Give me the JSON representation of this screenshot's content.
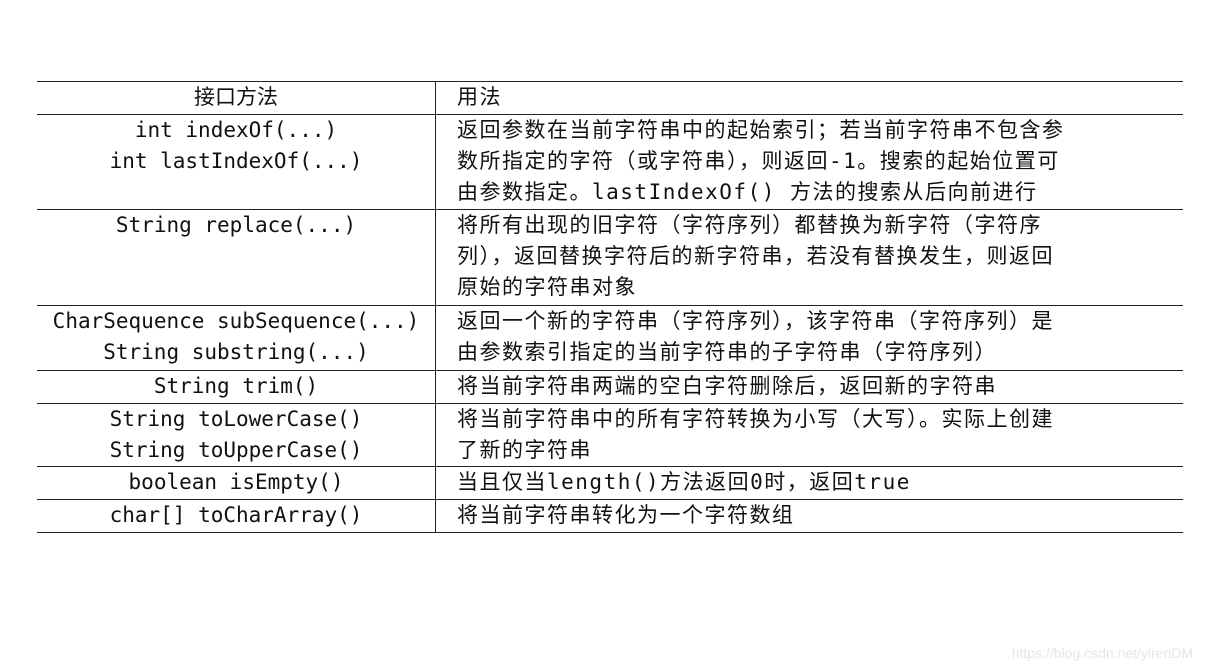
{
  "table": {
    "headers": [
      "接口方法",
      "用法"
    ],
    "rows": [
      {
        "method": [
          "int indexOf(...)",
          "int lastIndexOf(...)"
        ],
        "usage": [
          "返回参数在当前字符串中的起始索引；若当前字符串不包含参",
          "数所指定的字符（或字符串），则返回-1。搜索的起始位置可",
          "由参数指定。lastIndexOf() 方法的搜索从后向前进行"
        ]
      },
      {
        "method": [
          "String replace(...)"
        ],
        "usage": [
          "将所有出现的旧字符（字符序列）都替换为新字符（字符序",
          "列），返回替换字符后的新字符串，若没有替换发生，则返回",
          "原始的字符串对象"
        ]
      },
      {
        "method": [
          "CharSequence subSequence(...)",
          "String substring(...)"
        ],
        "usage": [
          "返回一个新的字符串（字符序列），该字符串（字符序列）是",
          "由参数索引指定的当前字符串的子字符串（字符序列）"
        ]
      },
      {
        "method": [
          "String trim()"
        ],
        "usage": [
          "将当前字符串两端的空白字符删除后，返回新的字符串"
        ]
      },
      {
        "method": [
          "String toLowerCase()",
          "String toUpperCase()"
        ],
        "usage": [
          "将当前字符串中的所有字符转换为小写（大写）。实际上创建",
          "了新的字符串"
        ]
      },
      {
        "method": [
          "boolean isEmpty()"
        ],
        "usage": [
          "当且仅当length()方法返回0时，返回true"
        ]
      },
      {
        "method": [
          "char[] toCharArray()"
        ],
        "usage": [
          "将当前字符串转化为一个字符数组"
        ]
      }
    ]
  },
  "watermark": "https://blog.csdn.net/yirenDM"
}
